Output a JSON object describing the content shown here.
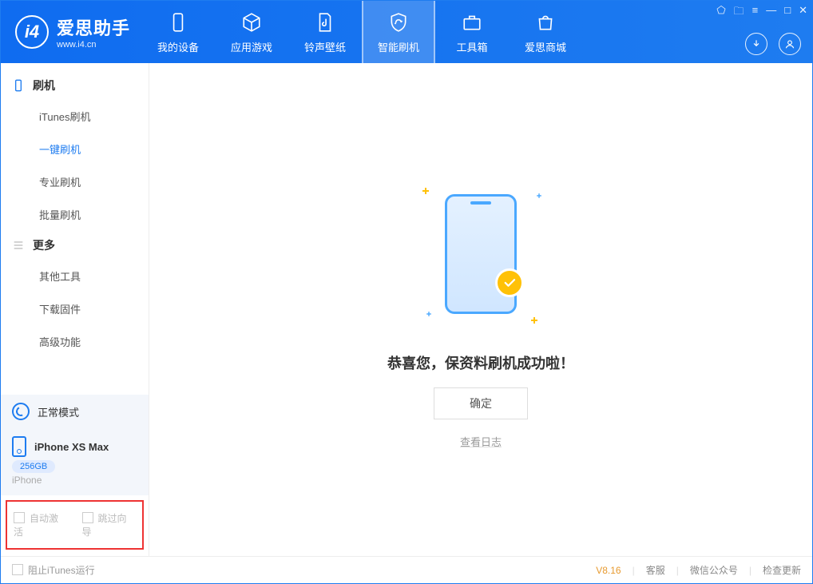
{
  "app": {
    "name": "爱思助手",
    "site": "www.i4.cn"
  },
  "nav": {
    "items": [
      {
        "label": "我的设备"
      },
      {
        "label": "应用游戏"
      },
      {
        "label": "铃声壁纸"
      },
      {
        "label": "智能刷机"
      },
      {
        "label": "工具箱"
      },
      {
        "label": "爱思商城"
      }
    ],
    "active_index": 3
  },
  "sidebar": {
    "groups": [
      {
        "title": "刷机",
        "icon": "phone",
        "items": [
          "iTunes刷机",
          "一键刷机",
          "专业刷机",
          "批量刷机"
        ],
        "active_index": 1
      },
      {
        "title": "更多",
        "icon": "list",
        "items": [
          "其他工具",
          "下载固件",
          "高级功能"
        ],
        "active_index": -1
      }
    ],
    "mode_label": "正常模式",
    "device": {
      "name": "iPhone XS Max",
      "storage": "256GB",
      "type": "iPhone"
    },
    "options": {
      "auto_activate": "自动激活",
      "skip_guide": "跳过向导"
    }
  },
  "main": {
    "success_message": "恭喜您，保资料刷机成功啦！",
    "ok_button": "确定",
    "view_log": "查看日志"
  },
  "footer": {
    "block_itunes": "阻止iTunes运行",
    "version": "V8.16",
    "links": [
      "客服",
      "微信公众号",
      "检查更新"
    ]
  }
}
